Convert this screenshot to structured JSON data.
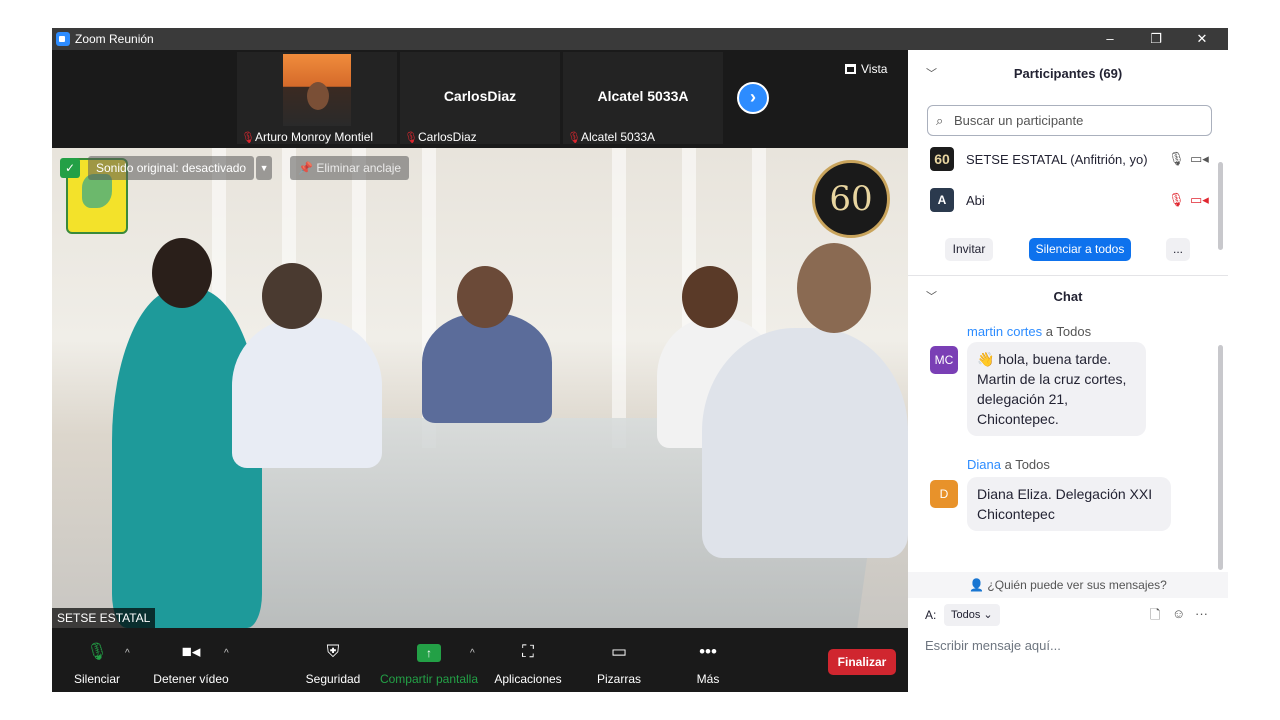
{
  "window": {
    "title": "Zoom Reunión",
    "controls": [
      "–",
      "❐",
      "✕"
    ]
  },
  "strip": {
    "tiles": [
      {
        "name": "",
        "label": "Arturo Monroy Montiel",
        "has_photo": true
      },
      {
        "name": "CarlosDiaz",
        "label": "CarlosDiaz",
        "has_photo": false
      },
      {
        "name": "Alcatel 5033A",
        "label": "Alcatel 5033A",
        "has_photo": false
      }
    ],
    "next_icon": "chevron-right-icon",
    "view_label": "Vista"
  },
  "main_video": {
    "overlay_sound": "Sonido original: desactivado",
    "overlay_unpin": "Eliminar anclaje",
    "speaker_name": "SETSE ESTATAL",
    "badge_text": "60"
  },
  "toolbar": {
    "mute_label": "Silenciar",
    "stop_video_label": "Detener vídeo",
    "security_label": "Seguridad",
    "share_label": "Compartir pantalla",
    "apps_label": "Aplicaciones",
    "whiteboards_label": "Pizarras",
    "more_label": "Más",
    "end_label": "Finalizar"
  },
  "participants": {
    "header": "Participantes (69)",
    "search_placeholder": "Buscar un participante",
    "list": [
      {
        "name": "SETSE ESTATAL (Anfitrión, yo)",
        "avatar": "60",
        "avatar_color": "#1c1c1c",
        "muted": false
      },
      {
        "name": "Abi",
        "avatar": "A",
        "avatar_color": "#2b3a4e",
        "muted": true
      }
    ],
    "invite_label": "Invitar",
    "mute_all_label": "Silenciar a todos",
    "more_label": "..."
  },
  "chat": {
    "header": "Chat",
    "messages": [
      {
        "sender": "martin cortes",
        "to": "a Todos",
        "initials": "MC",
        "avatar_color": "#7a3fb5",
        "text": "👋 hola, buena tarde. Martin de la cruz cortes, delegación 21, Chicontepec."
      },
      {
        "sender": "Diana",
        "to": "a Todos",
        "initials": "D",
        "avatar_color": "#e8922a",
        "text": "Diana Eliza. Delegación XXI Chicontepec"
      }
    ],
    "who_can_see": "¿Quién puede ver sus mensajes?",
    "to_label": "A:",
    "to_value": "Todos",
    "input_placeholder": "Escribir mensaje aquí..."
  }
}
